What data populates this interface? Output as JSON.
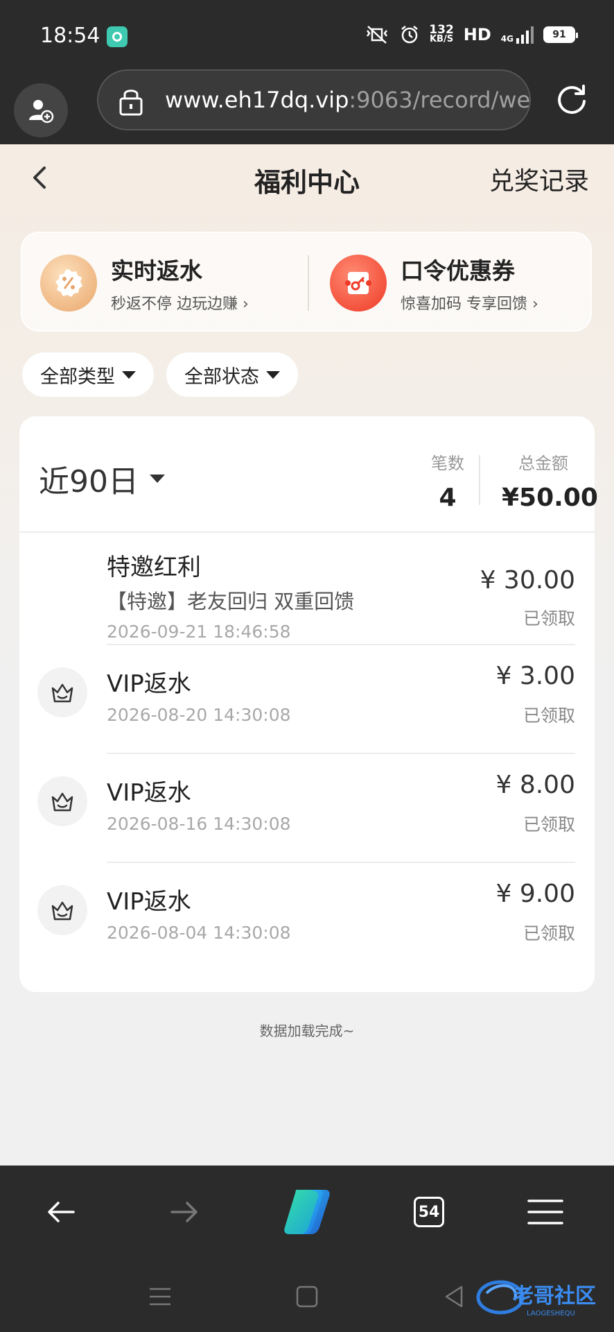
{
  "status_bar": {
    "time": "18:54",
    "net_speed_value": "132",
    "net_speed_unit": "KB/S",
    "hd_label": "HD",
    "network_type": "4G",
    "battery": "91"
  },
  "browser": {
    "url_host": "www.eh17dq.vip",
    "url_rest": ":9063/record/we"
  },
  "header": {
    "title": "福利中心",
    "redeem_records": "兑奖记录"
  },
  "promos": [
    {
      "title": "实时返水",
      "subtitle": "秒返不停 边玩边赚",
      "icon": "percent-badge-icon"
    },
    {
      "title": "口令优惠券",
      "subtitle": "惊喜加码 专享回馈",
      "icon": "key-coupon-icon"
    }
  ],
  "filters": {
    "type": "全部类型",
    "status": "全部状态"
  },
  "summary": {
    "period": "近90日",
    "count_label": "笔数",
    "count_value": "4",
    "total_label": "总金额",
    "total_value": "¥50.00"
  },
  "records": [
    {
      "title": "特邀红利",
      "desc": "【特邀】老友回归 双重回馈",
      "date": "2026-09-21 18:46:58",
      "amount": "¥ 30.00",
      "status": "已领取",
      "icon": ""
    },
    {
      "title": "VIP返水",
      "desc": "",
      "date": "2026-08-20 14:30:08",
      "amount": "¥ 3.00",
      "status": "已领取",
      "icon": "crown-icon"
    },
    {
      "title": "VIP返水",
      "desc": "",
      "date": "2026-08-16 14:30:08",
      "amount": "¥ 8.00",
      "status": "已领取",
      "icon": "crown-icon"
    },
    {
      "title": "VIP返水",
      "desc": "",
      "date": "2026-08-04 14:30:08",
      "amount": "¥ 9.00",
      "status": "已领取",
      "icon": "crown-icon"
    }
  ],
  "footer_note": "数据加载完成~",
  "toolbar": {
    "tabs_count": "54"
  },
  "watermark": {
    "text": "老哥社区",
    "subtext": "LAOGESHEQU"
  }
}
